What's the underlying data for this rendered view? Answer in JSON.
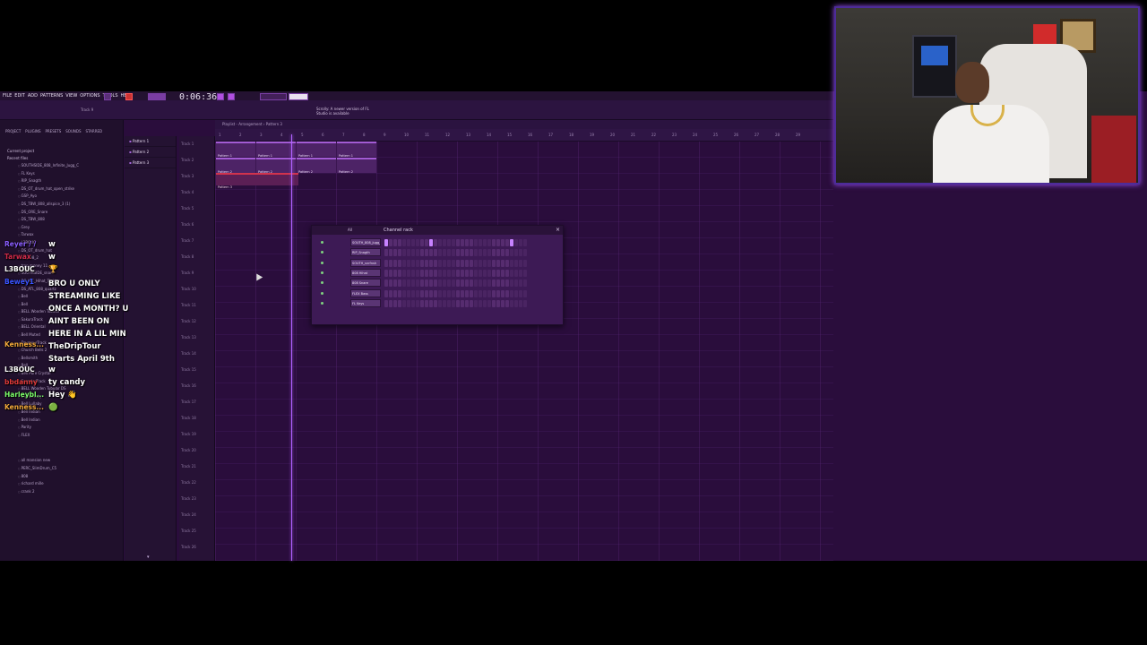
{
  "menu": [
    "FILE",
    "EDIT",
    "ADD",
    "PATTERNS",
    "VIEW",
    "OPTIONS",
    "TOOLS",
    "HELP"
  ],
  "transport": {
    "time": "0:06:36"
  },
  "toolbar_hint": "Scrolly: A newer version of FL Studio is available",
  "track_label": "Track 9",
  "playlist": {
    "title": "Playlist - Arrangement › Pattern 3",
    "ruler": [
      "1",
      "2",
      "3",
      "4",
      "5",
      "6",
      "7",
      "8",
      "9",
      "10",
      "11",
      "12",
      "13",
      "14",
      "15",
      "16",
      "17",
      "18",
      "19",
      "20",
      "21",
      "22",
      "23",
      "24",
      "25",
      "26",
      "27",
      "28",
      "29"
    ],
    "tracks": [
      "Track 1",
      "Track 2",
      "Track 3",
      "Track 4",
      "Track 5",
      "Track 6",
      "Track 7",
      "Track 8",
      "Track 9",
      "Track 10",
      "Track 11",
      "Track 12",
      "Track 13",
      "Track 14",
      "Track 15",
      "Track 16",
      "Track 17",
      "Track 18",
      "Track 19",
      "Track 20",
      "Track 21",
      "Track 22",
      "Track 23",
      "Track 24",
      "Track 25",
      "Track 26"
    ],
    "clips_row1": [
      "Pattern 1",
      "Pattern 1",
      "Pattern 1",
      "Pattern 1"
    ],
    "clips_row2": [
      "Pattern 2",
      "Pattern 2",
      "Pattern 2",
      "Pattern 2"
    ],
    "clip_red": "Pattern 3"
  },
  "patterns": [
    "Pattern 1",
    "Pattern 2",
    "Pattern 3"
  ],
  "browser": {
    "tabs": [
      "PROJECT",
      "PLUGINS",
      "PRESETS",
      "SOUNDS",
      "STARRED"
    ],
    "header": "Current project",
    "recent": "Recent files",
    "items": [
      "SOUTHSIDE_808_Infinite_Jugg_C",
      "FL Keys",
      "RIP_Snagth",
      "DS_OT_drum_hat_open_strike",
      "GSP_Ayo",
      "DS_TBW_808_allspice_3 (1)",
      "DS_ORE_Snare",
      "DS_TBW_808",
      "Grey",
      "Tarwax",
      "L3BOUC",
      "DS_OT_drum_hat",
      "VT_808_2",
      "trap money 11",
      "SOUTHSIDE_snare",
      "DS_WC_Hihat_Tighter",
      "DS_ATL_808_quartz",
      "Bell",
      "Bell",
      "BELL Wooden Tubular",
      "SakuraTrack",
      "BELL Oriental",
      "Bell Muted",
      "DrumourTrack",
      "Church Bells 2",
      "Bellsmith",
      "Bell",
      "Bell Pure Crystal",
      "SamplerTrack",
      "BELL Wooden Tubular DS",
      "Bell Lullaby",
      "Bell Lullaby",
      "Bell Indian",
      "Bell Indian",
      "Parity",
      "FLEX"
    ],
    "bottom_items": [
      "all mansion new",
      "PERC_SlimDrum_C5",
      "808",
      "richard mille",
      "crank 2"
    ]
  },
  "channel_rack": {
    "title": "Channel rack",
    "filter": "All",
    "channels": [
      {
        "name": "SOUTH_808_Jugg_C",
        "steps": [
          1,
          0,
          0,
          0,
          0,
          0,
          0,
          0,
          0,
          0,
          1,
          0,
          0,
          0,
          0,
          0,
          0,
          0,
          0,
          0,
          0,
          0,
          0,
          0,
          0,
          0,
          0,
          0,
          1,
          0,
          0,
          0
        ]
      },
      {
        "name": "RIP_Snagth",
        "steps": [
          0,
          0,
          0,
          0,
          0,
          0,
          0,
          0,
          0,
          0,
          0,
          0,
          0,
          0,
          0,
          0,
          0,
          0,
          0,
          0,
          0,
          0,
          0,
          0,
          0,
          0,
          0,
          0,
          0,
          0,
          0,
          0
        ]
      },
      {
        "name": "SOUTH_snrfnsh",
        "steps": [
          0,
          0,
          0,
          0,
          0,
          0,
          0,
          0,
          0,
          0,
          0,
          0,
          0,
          0,
          0,
          0,
          0,
          0,
          0,
          0,
          0,
          0,
          0,
          0,
          0,
          0,
          0,
          0,
          0,
          0,
          0,
          0
        ]
      },
      {
        "name": "808 Hihat",
        "steps": [
          0,
          0,
          0,
          0,
          0,
          0,
          0,
          0,
          0,
          0,
          0,
          0,
          0,
          0,
          0,
          0,
          0,
          0,
          0,
          0,
          0,
          0,
          0,
          0,
          0,
          0,
          0,
          0,
          0,
          0,
          0,
          0
        ]
      },
      {
        "name": "808 Snare",
        "steps": [
          0,
          0,
          0,
          0,
          0,
          0,
          0,
          0,
          0,
          0,
          0,
          0,
          0,
          0,
          0,
          0,
          0,
          0,
          0,
          0,
          0,
          0,
          0,
          0,
          0,
          0,
          0,
          0,
          0,
          0,
          0,
          0
        ]
      },
      {
        "name": "FLEX Bass",
        "steps": [
          0,
          0,
          0,
          0,
          0,
          0,
          0,
          0,
          0,
          0,
          0,
          0,
          0,
          0,
          0,
          0,
          0,
          0,
          0,
          0,
          0,
          0,
          0,
          0,
          0,
          0,
          0,
          0,
          0,
          0,
          0,
          0
        ]
      },
      {
        "name": "FL Keys",
        "steps": [
          0,
          0,
          0,
          0,
          0,
          0,
          0,
          0,
          0,
          0,
          0,
          0,
          0,
          0,
          0,
          0,
          0,
          0,
          0,
          0,
          0,
          0,
          0,
          0,
          0,
          0,
          0,
          0,
          0,
          0,
          0,
          0
        ]
      }
    ]
  },
  "chat": [
    {
      "user": "Reyer / /",
      "text": "w",
      "color": "#8a5cff"
    },
    {
      "user": "Tarwax",
      "text": "w",
      "color": "#d12a4a"
    },
    {
      "user": "L3BOUC",
      "text": "🏆",
      "color": "#ffffff"
    },
    {
      "user": "Bewey1",
      "text": "BRO U ONLY STREAMING LIKE ONCE A MONTH? U AINT BEEN ON HERE IN A LIL MIN",
      "color": "#3a53ff",
      "multi": true
    },
    {
      "user": "Kenness...",
      "text": "TheDripTour Starts April 9th",
      "color": "#f2a93b",
      "multi": true
    },
    {
      "user": "L3BOUC",
      "text": "w",
      "color": "#ffffff"
    },
    {
      "user": "bbdanny",
      "text": "ty candy",
      "color": "#e03a3a"
    },
    {
      "user": "Harleybl...",
      "text": "Hey 👋",
      "color": "#7dff6b"
    },
    {
      "user": "Kenness...",
      "text": "🟢",
      "color": "#f2a93b"
    }
  ]
}
